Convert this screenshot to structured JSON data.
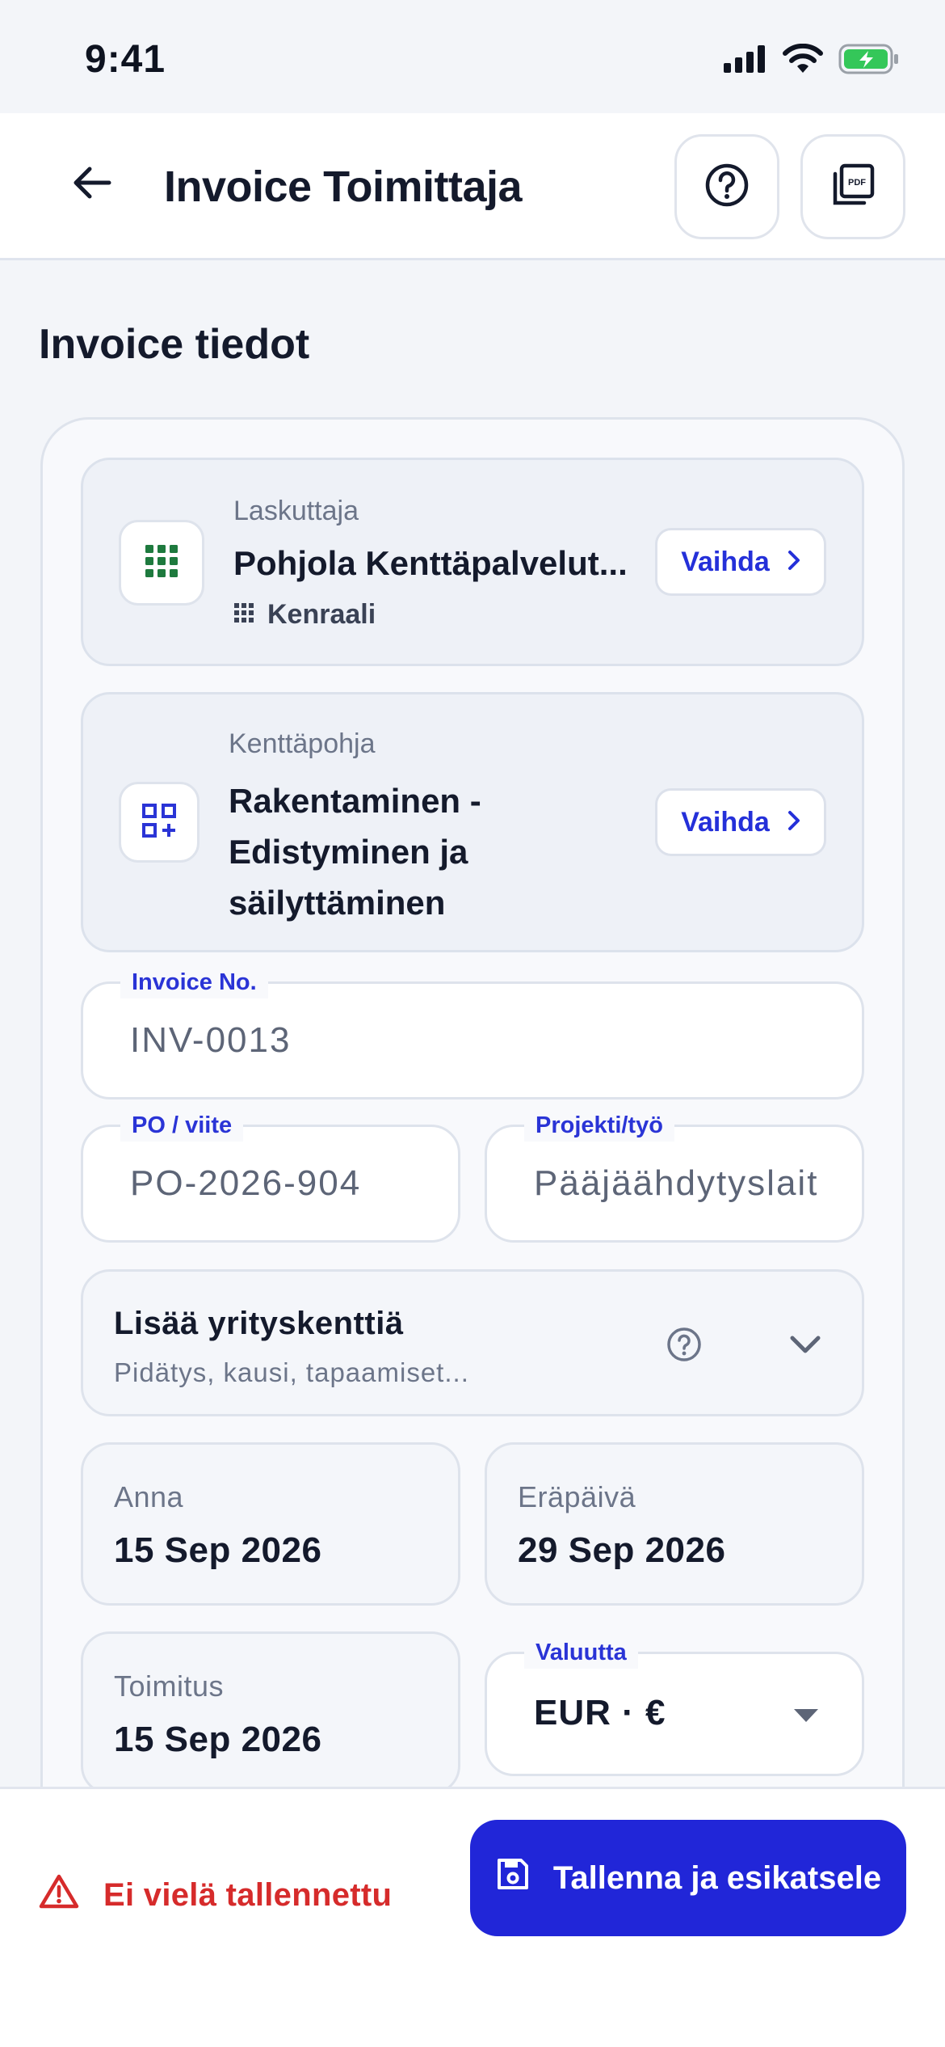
{
  "status_bar": {
    "time": "9:41"
  },
  "app_bar": {
    "title": "Invoice Toimittaja"
  },
  "section_title": "Invoice tiedot",
  "biller": {
    "caption": "Laskuttaja",
    "name": "Pohjola Kenttäpalvelut...",
    "sub": "Kenraali",
    "change_label": "Vaihda"
  },
  "template": {
    "caption": "Kenttäpohja",
    "name_lines": [
      "Rakentaminen -",
      "Edistyminen ja",
      "säilyttäminen"
    ],
    "change_label": "Vaihda"
  },
  "fields": {
    "invoice_no": {
      "label": "Invoice No.",
      "value": "INV-0013"
    },
    "po": {
      "label": "PO / viite",
      "value": "PO-2026-904"
    },
    "project": {
      "label": "Projekti/työ",
      "value": "Pääjäähdytyslaitt"
    }
  },
  "business_fields": {
    "title": "Lisää yrityskenttiä",
    "subtitle": "Pidätys, kausi, tapaamiset..."
  },
  "dates": {
    "issue": {
      "caption": "Anna",
      "value": "15 Sep 2026"
    },
    "due": {
      "caption": "Eräpäivä",
      "value": "29 Sep 2026"
    },
    "delivery": {
      "caption": "Toimitus",
      "value": "15 Sep 2026"
    }
  },
  "currency": {
    "label": "Valuutta",
    "value": "EUR · €"
  },
  "bottom": {
    "status": "Ei vielä tallennettu",
    "save_label": "Tallenna ja esikatsele"
  },
  "colors": {
    "accent": "#2126D8",
    "error": "#D62B2B",
    "battery": "#34C759",
    "grid_icon": "#1E7A3E"
  },
  "icons": [
    "signal-icon",
    "wifi-icon",
    "battery-icon",
    "back-arrow-icon",
    "help-icon",
    "pdf-icon",
    "grid-icon",
    "qr-add-icon",
    "chevron-right-icon",
    "chevron-down-icon",
    "caret-down-icon",
    "warning-icon",
    "save-icon"
  ]
}
